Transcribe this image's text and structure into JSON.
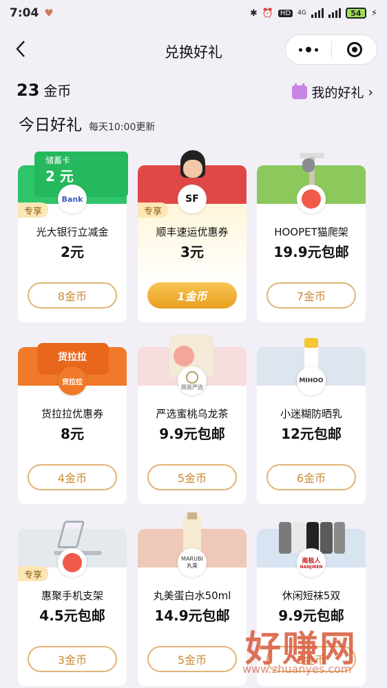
{
  "status": {
    "time": "7:04",
    "hd": "HD",
    "network": "4G",
    "battery": "54"
  },
  "nav": {
    "title": "兑换好礼"
  },
  "header": {
    "coins_value": "23",
    "coins_label": "金币",
    "my_gifts": "我的好礼",
    "my_gifts_arrow": "›"
  },
  "section": {
    "title": "今日好礼",
    "subtitle": "每天10:00更新"
  },
  "cards": [
    {
      "name": "光大银行立减金",
      "price": "2元",
      "button": "8金币",
      "exclusive": "专享",
      "logo": "Bank",
      "banner_text1": "储蓄卡",
      "banner_text2": "2 元"
    },
    {
      "name": "顺丰速运优惠券",
      "price": "3元",
      "button": "1金币",
      "exclusive": "专享",
      "logo": "SF"
    },
    {
      "name": "HOOPET猫爬架",
      "price": "19.9元包邮",
      "button": "7金币"
    },
    {
      "name": "货拉拉优惠券",
      "price": "8元",
      "button": "4金币",
      "logo": "货拉拉",
      "banner_text1": "货拉拉"
    },
    {
      "name": "严选蜜桃乌龙茶",
      "price": "9.9元包邮",
      "button": "5金币",
      "logo_sub": "网易严选"
    },
    {
      "name": "小迷糊防晒乳",
      "price": "12元包邮",
      "button": "6金币",
      "logo": "MIHOO"
    },
    {
      "name": "惠聚手机支架",
      "price": "4.5元包邮",
      "button": "3金币",
      "exclusive": "专享"
    },
    {
      "name": "丸美蛋白水50ml",
      "price": "14.9元包邮",
      "button": "5金币",
      "logo": "MARUBI",
      "logo_sub": "丸美"
    },
    {
      "name": "休闲短袜5双",
      "price": "9.9元包邮",
      "button": "5金币",
      "logo": "南极人",
      "logo_sub": "NANJIREN"
    }
  ],
  "watermark": {
    "big": "好赚网",
    "url": "www.zhuanyes.com"
  },
  "colors": {
    "accent": "#e9a020",
    "button_border": "#e1b274",
    "button_text": "#c98a32"
  }
}
